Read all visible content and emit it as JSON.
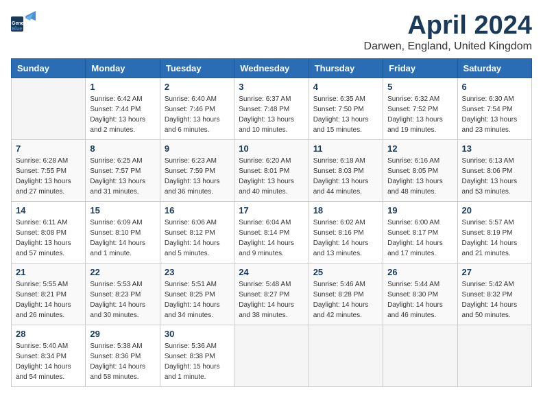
{
  "header": {
    "logo_general": "General",
    "logo_blue": "Blue",
    "month": "April 2024",
    "location": "Darwen, England, United Kingdom"
  },
  "days_of_week": [
    "Sunday",
    "Monday",
    "Tuesday",
    "Wednesday",
    "Thursday",
    "Friday",
    "Saturday"
  ],
  "weeks": [
    [
      {
        "day": "",
        "info": ""
      },
      {
        "day": "1",
        "info": "Sunrise: 6:42 AM\nSunset: 7:44 PM\nDaylight: 13 hours\nand 2 minutes."
      },
      {
        "day": "2",
        "info": "Sunrise: 6:40 AM\nSunset: 7:46 PM\nDaylight: 13 hours\nand 6 minutes."
      },
      {
        "day": "3",
        "info": "Sunrise: 6:37 AM\nSunset: 7:48 PM\nDaylight: 13 hours\nand 10 minutes."
      },
      {
        "day": "4",
        "info": "Sunrise: 6:35 AM\nSunset: 7:50 PM\nDaylight: 13 hours\nand 15 minutes."
      },
      {
        "day": "5",
        "info": "Sunrise: 6:32 AM\nSunset: 7:52 PM\nDaylight: 13 hours\nand 19 minutes."
      },
      {
        "day": "6",
        "info": "Sunrise: 6:30 AM\nSunset: 7:54 PM\nDaylight: 13 hours\nand 23 minutes."
      }
    ],
    [
      {
        "day": "7",
        "info": "Sunrise: 6:28 AM\nSunset: 7:55 PM\nDaylight: 13 hours\nand 27 minutes."
      },
      {
        "day": "8",
        "info": "Sunrise: 6:25 AM\nSunset: 7:57 PM\nDaylight: 13 hours\nand 31 minutes."
      },
      {
        "day": "9",
        "info": "Sunrise: 6:23 AM\nSunset: 7:59 PM\nDaylight: 13 hours\nand 36 minutes."
      },
      {
        "day": "10",
        "info": "Sunrise: 6:20 AM\nSunset: 8:01 PM\nDaylight: 13 hours\nand 40 minutes."
      },
      {
        "day": "11",
        "info": "Sunrise: 6:18 AM\nSunset: 8:03 PM\nDaylight: 13 hours\nand 44 minutes."
      },
      {
        "day": "12",
        "info": "Sunrise: 6:16 AM\nSunset: 8:05 PM\nDaylight: 13 hours\nand 48 minutes."
      },
      {
        "day": "13",
        "info": "Sunrise: 6:13 AM\nSunset: 8:06 PM\nDaylight: 13 hours\nand 53 minutes."
      }
    ],
    [
      {
        "day": "14",
        "info": "Sunrise: 6:11 AM\nSunset: 8:08 PM\nDaylight: 13 hours\nand 57 minutes."
      },
      {
        "day": "15",
        "info": "Sunrise: 6:09 AM\nSunset: 8:10 PM\nDaylight: 14 hours\nand 1 minute."
      },
      {
        "day": "16",
        "info": "Sunrise: 6:06 AM\nSunset: 8:12 PM\nDaylight: 14 hours\nand 5 minutes."
      },
      {
        "day": "17",
        "info": "Sunrise: 6:04 AM\nSunset: 8:14 PM\nDaylight: 14 hours\nand 9 minutes."
      },
      {
        "day": "18",
        "info": "Sunrise: 6:02 AM\nSunset: 8:16 PM\nDaylight: 14 hours\nand 13 minutes."
      },
      {
        "day": "19",
        "info": "Sunrise: 6:00 AM\nSunset: 8:17 PM\nDaylight: 14 hours\nand 17 minutes."
      },
      {
        "day": "20",
        "info": "Sunrise: 5:57 AM\nSunset: 8:19 PM\nDaylight: 14 hours\nand 21 minutes."
      }
    ],
    [
      {
        "day": "21",
        "info": "Sunrise: 5:55 AM\nSunset: 8:21 PM\nDaylight: 14 hours\nand 26 minutes."
      },
      {
        "day": "22",
        "info": "Sunrise: 5:53 AM\nSunset: 8:23 PM\nDaylight: 14 hours\nand 30 minutes."
      },
      {
        "day": "23",
        "info": "Sunrise: 5:51 AM\nSunset: 8:25 PM\nDaylight: 14 hours\nand 34 minutes."
      },
      {
        "day": "24",
        "info": "Sunrise: 5:48 AM\nSunset: 8:27 PM\nDaylight: 14 hours\nand 38 minutes."
      },
      {
        "day": "25",
        "info": "Sunrise: 5:46 AM\nSunset: 8:28 PM\nDaylight: 14 hours\nand 42 minutes."
      },
      {
        "day": "26",
        "info": "Sunrise: 5:44 AM\nSunset: 8:30 PM\nDaylight: 14 hours\nand 46 minutes."
      },
      {
        "day": "27",
        "info": "Sunrise: 5:42 AM\nSunset: 8:32 PM\nDaylight: 14 hours\nand 50 minutes."
      }
    ],
    [
      {
        "day": "28",
        "info": "Sunrise: 5:40 AM\nSunset: 8:34 PM\nDaylight: 14 hours\nand 54 minutes."
      },
      {
        "day": "29",
        "info": "Sunrise: 5:38 AM\nSunset: 8:36 PM\nDaylight: 14 hours\nand 58 minutes."
      },
      {
        "day": "30",
        "info": "Sunrise: 5:36 AM\nSunset: 8:38 PM\nDaylight: 15 hours\nand 1 minute."
      },
      {
        "day": "",
        "info": ""
      },
      {
        "day": "",
        "info": ""
      },
      {
        "day": "",
        "info": ""
      },
      {
        "day": "",
        "info": ""
      }
    ]
  ]
}
